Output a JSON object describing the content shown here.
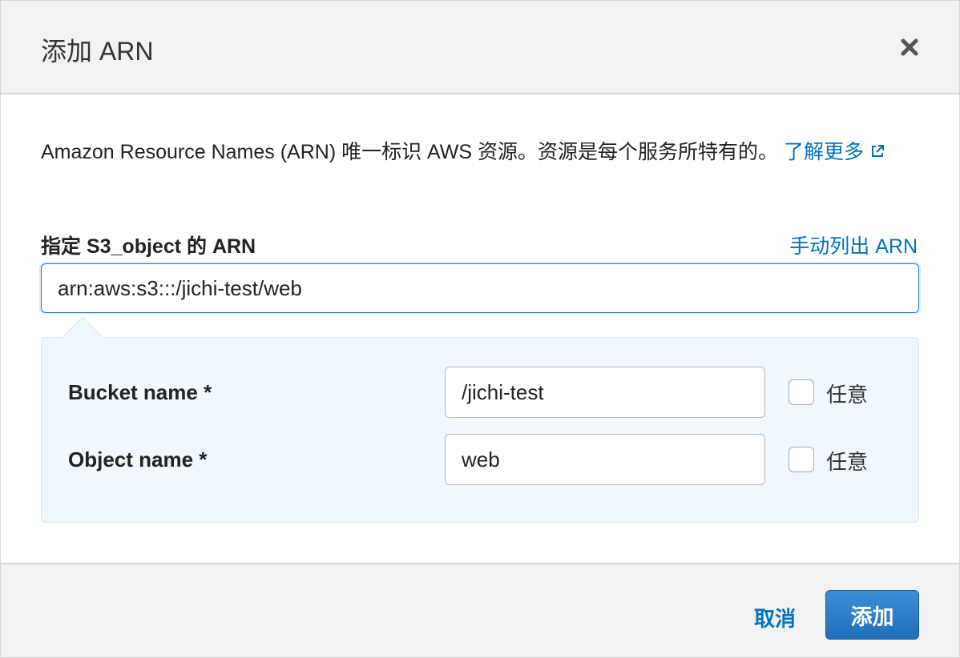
{
  "header": {
    "title": "添加 ARN",
    "close_icon": "close-icon"
  },
  "description": {
    "text": "Amazon Resource Names (ARN) 唯一标识 AWS 资源。资源是每个服务所特有的。",
    "learn_more_label": "了解更多",
    "external_link_icon": "external-link-icon"
  },
  "arn_field": {
    "label": "指定 S3_object 的 ARN",
    "manual_link_label": "手动列出 ARN",
    "value": "arn:aws:s3:::/jichi-test/web"
  },
  "components": [
    {
      "label": "Bucket name *",
      "value": "/jichi-test",
      "any_label": "任意",
      "any_checked": false
    },
    {
      "label": "Object name *",
      "value": "web",
      "any_label": "任意",
      "any_checked": false
    }
  ],
  "footer": {
    "cancel_label": "取消",
    "add_label": "添加"
  },
  "colors": {
    "link": "#0073bb",
    "primary_button": "#1f6fb8",
    "detail_background": "#f0f7fd"
  }
}
